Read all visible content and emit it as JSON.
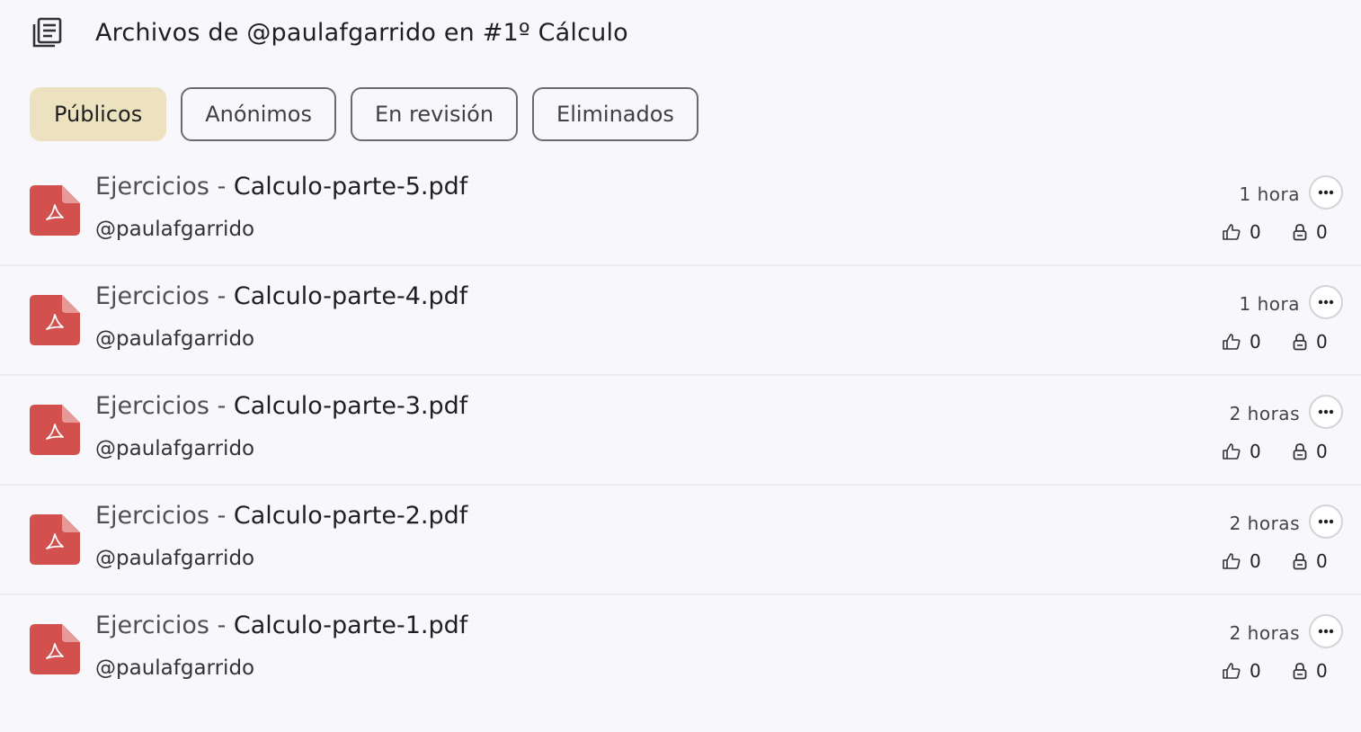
{
  "header": {
    "title": "Archivos de @paulafgarrido en #1º Cálculo",
    "icon": "document-list-icon"
  },
  "tabs": [
    {
      "label": "Públicos",
      "active": true
    },
    {
      "label": "Anónimos",
      "active": false
    },
    {
      "label": "En revisión",
      "active": false
    },
    {
      "label": "Eliminados",
      "active": false
    }
  ],
  "files": [
    {
      "category": "Ejercicios",
      "separator": "-",
      "name": "Calculo-parte-5.pdf",
      "author": "@paulafgarrido",
      "time": "1 hora",
      "likes": "0",
      "locks": "0"
    },
    {
      "category": "Ejercicios",
      "separator": "-",
      "name": "Calculo-parte-4.pdf",
      "author": "@paulafgarrido",
      "time": "1 hora",
      "likes": "0",
      "locks": "0"
    },
    {
      "category": "Ejercicios",
      "separator": "-",
      "name": "Calculo-parte-3.pdf",
      "author": "@paulafgarrido",
      "time": "2 horas",
      "likes": "0",
      "locks": "0"
    },
    {
      "category": "Ejercicios",
      "separator": "-",
      "name": "Calculo-parte-2.pdf",
      "author": "@paulafgarrido",
      "time": "2 horas",
      "likes": "0",
      "locks": "0"
    },
    {
      "category": "Ejercicios",
      "separator": "-",
      "name": "Calculo-parte-1.pdf",
      "author": "@paulafgarrido",
      "time": "2 horas",
      "likes": "0",
      "locks": "0"
    }
  ],
  "colors": {
    "active_tab": "#ede2c0",
    "pdf_icon": "#d2504e",
    "background": "#f8f8fc"
  }
}
